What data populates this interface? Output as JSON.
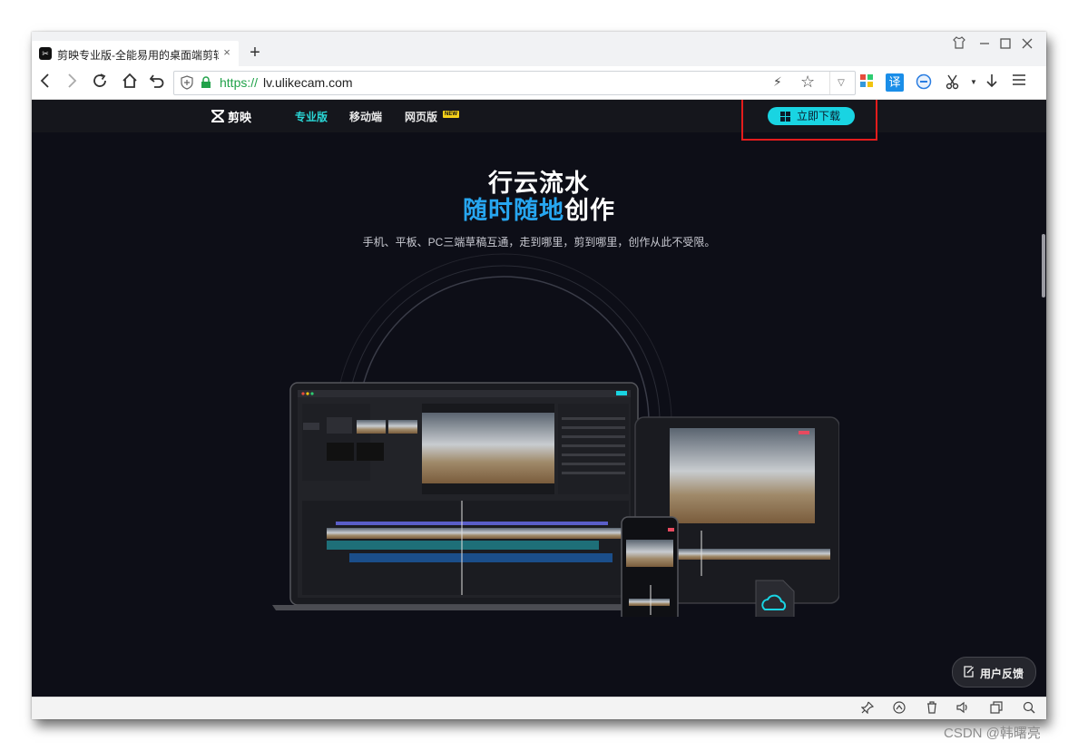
{
  "browser": {
    "tab": {
      "title": "剪映专业版-全能易用的桌面端剪辑软件",
      "favicon_text": "✂",
      "close_glyph": "×"
    },
    "new_tab_glyph": "+",
    "url": {
      "scheme": "https://",
      "host": "lv.ulikecam.com"
    },
    "translate_label": "译"
  },
  "site": {
    "logo_text": "剪映",
    "nav": [
      {
        "label": "专业版",
        "active": true
      },
      {
        "label": "移动端",
        "active": false
      },
      {
        "label": "网页版",
        "active": false
      }
    ],
    "new_badge": "NEW",
    "download_button": "立即下载",
    "headline_line1": "行云流水",
    "headline_line2_highlight": "随时随地",
    "headline_line2_rest": "创作",
    "subtitle": "手机、平板、PC三端草稿互通，走到哪里，剪到哪里，创作从此不受限。",
    "feedback_button": "用户反馈",
    "colors": {
      "accent": "#19d4e2",
      "highlight": "#27a6f0",
      "page_bg": "#0d0e17",
      "annotation": "#e41c1c"
    }
  },
  "watermark": "CSDN @韩曙亮"
}
